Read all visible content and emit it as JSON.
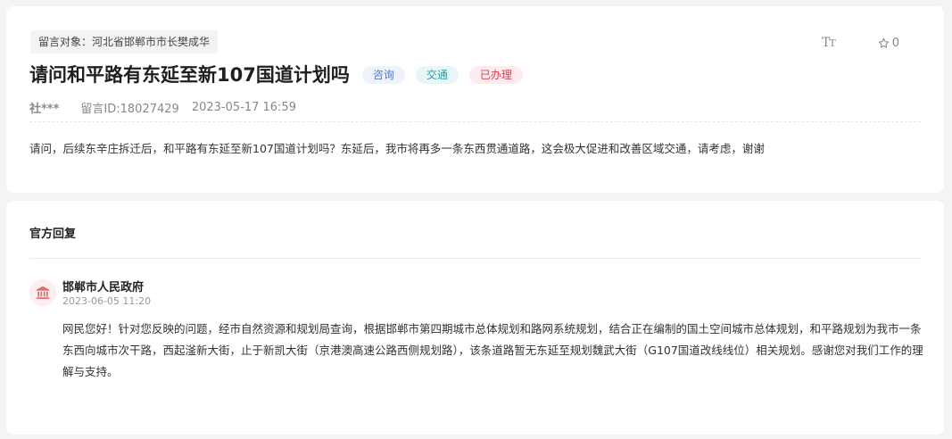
{
  "message": {
    "target": "留言对象：河北省邯郸市市长樊成华",
    "title": "请问和平路有东延至新107国道计划吗",
    "tags": [
      "咨询",
      "交通",
      "已办理"
    ],
    "author": "社***",
    "message_id": "留言ID:18027429",
    "datetime": "2023-05-17 16:59",
    "content": "请问，后续东辛庄拆迁后，和平路有东延至新107国道计划吗？东延后，我市将再多一条东西贯通道路，这会极大促进和改善区域交通，请考虑，谢谢",
    "font_size_label": "T",
    "font_size_label_small": "T",
    "favorite_count": "0"
  },
  "reply": {
    "heading": "官方回复",
    "department": "邯郸市人民政府",
    "datetime": "2023-06-05 11:20",
    "text": "网民您好！针对您反映的问题，经市自然资源和规划局查询，根据邯郸市第四期城市总体规划和路网系统规划，结合正在编制的国土空间城市总体规划，和平路规划为我市一条东西向城市次干路，西起滏新大街，止于新凯大街（京港澳高速公路西侧规划路），该条道路暂无东延至规划魏武大街（G107国道改线线位）相关规划。感谢您对我们工作的理解与支持。"
  },
  "colors": {
    "background": "#f3f4f6",
    "tag_consult": "#5b7bc0",
    "tag_traffic": "#2e9aa6",
    "tag_done": "#d9414e",
    "gov_icon": "#e06a6a"
  },
  "icons": [
    "font-size-icon",
    "star-icon",
    "government-building-icon"
  ]
}
